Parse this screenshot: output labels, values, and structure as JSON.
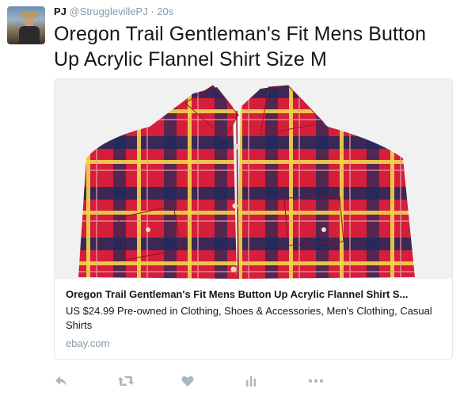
{
  "tweet": {
    "author_name": "PJ",
    "author_handle": "@StrugglevillePJ",
    "separator": "·",
    "time": "20s",
    "text": "Oregon Trail Gentleman's Fit Mens Button Up Acrylic Flannel Shirt Size M"
  },
  "card": {
    "title": "Oregon Trail Gentleman's Fit Mens Button Up Acrylic Flannel Shirt S...",
    "description": "US $24.99 Pre-owned in Clothing, Shoes & Accessories, Men's Clothing, Casual Shirts",
    "domain": "ebay.com",
    "image_icon": "plaid-flannel-shirt-photo"
  },
  "actions": [
    {
      "name": "reply-icon"
    },
    {
      "name": "retweet-icon"
    },
    {
      "name": "like-icon"
    },
    {
      "name": "analytics-icon"
    },
    {
      "name": "more-icon"
    }
  ],
  "colors": {
    "text_primary": "#14171a",
    "text_secondary": "#8899a6",
    "border": "#e1e8ed",
    "icon": "#aab8c2",
    "plaid_red": "#d41e3a",
    "plaid_navy": "#1e2a5a",
    "plaid_yellow": "#f2d64b"
  }
}
